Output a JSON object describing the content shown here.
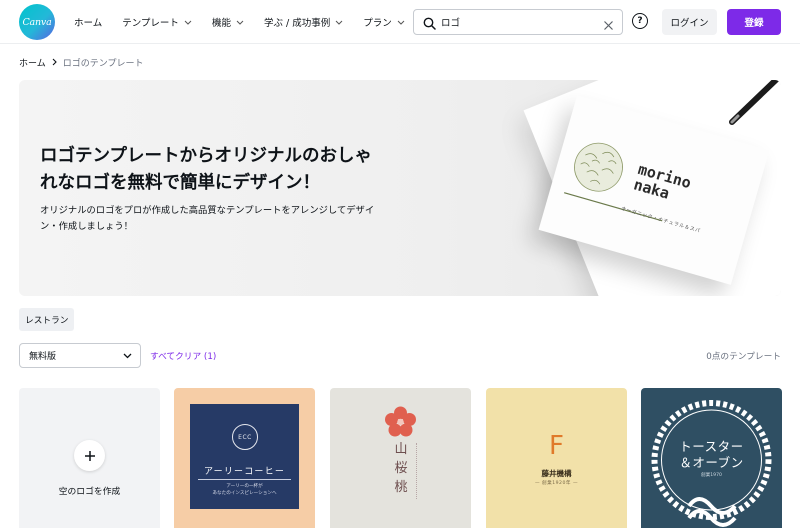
{
  "header": {
    "logo_text": "Canva",
    "nav": [
      {
        "label": "ホーム",
        "has_menu": false
      },
      {
        "label": "テンプレート",
        "has_menu": true
      },
      {
        "label": "機能",
        "has_menu": true
      },
      {
        "label": "学ぶ / 成功事例",
        "has_menu": true
      },
      {
        "label": "プラン",
        "has_menu": true
      }
    ],
    "search_value": "ロゴ",
    "help_label": "?",
    "login_label": "ログイン",
    "signup_label": "登録"
  },
  "breadcrumb": {
    "home": "ホーム",
    "current": "ロゴのテンプレート"
  },
  "hero": {
    "title": "ロゴテンプレートからオリジナルのおしゃれなロゴを無料で簡単にデザイン！",
    "subtitle": "オリジナルのロゴをプロが作成した高品質なテンプレートをアレンジしてデザイン・作成しましょう！",
    "mockup_brand": "morino naka",
    "mockup_tagline": "オーガニック・ナチュラル＆スパ"
  },
  "filters": {
    "chip_label": "レストラン",
    "select_value": "無料版",
    "clear_all_label": "すべてクリア (1)",
    "count_label": "0点のテンプレート"
  },
  "templates": {
    "blank_label": "空のロゴを作成",
    "coffee": {
      "badge": "ECC",
      "name": "アーリーコーヒー",
      "tagline_1": "アーリーの一杯が",
      "tagline_2": "あなたのインスピレーションへ",
      "bg_color": "#f6cda6",
      "card_color": "#263a66"
    },
    "sakura": {
      "name": "山桜桃",
      "bg_color": "#e4e3dd",
      "accent_color": "#e0604f"
    },
    "fujii": {
      "letter": "F",
      "name": "藤井機構",
      "tagline": "— 創業1920年 —",
      "bg_color": "#f2e1a9",
      "accent_color": "#e07a2a"
    },
    "toaster": {
      "name_1": "トースター",
      "name_2": "＆オーブン",
      "tagline": "創業1970",
      "bg_color": "#2f4f63"
    }
  },
  "colors": {
    "brand_purple": "#7d2ae8",
    "brand_teal": "#00c4cc"
  }
}
